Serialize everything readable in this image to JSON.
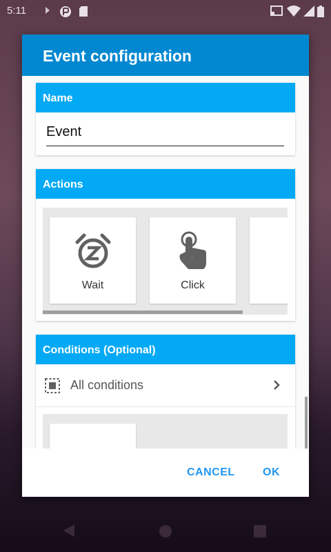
{
  "status_bar": {
    "time": "5:11",
    "icons": [
      "play-protect-icon",
      "app-notification-icon",
      "sd-card-icon",
      "cast-icon",
      "wifi-icon",
      "signal-icon",
      "battery-icon"
    ]
  },
  "dialog": {
    "title": "Event configuration",
    "name_section": {
      "header": "Name",
      "value": "Event"
    },
    "actions_section": {
      "header": "Actions",
      "items": [
        {
          "label": "Wait",
          "icon": "timer-z-icon"
        },
        {
          "label": "Click",
          "icon": "tap-hand-icon"
        }
      ]
    },
    "conditions_section": {
      "header": "Conditions (Optional)",
      "all_conditions_label": "All conditions",
      "icon": "select-all-icon"
    },
    "buttons": {
      "cancel": "CANCEL",
      "ok": "OK"
    }
  },
  "nav_bar": {
    "icons": [
      "back-icon",
      "home-icon",
      "recents-icon"
    ]
  },
  "colors": {
    "header_dark": "#0288d1",
    "section_header": "#03a9f4",
    "button_text": "#2196f3"
  }
}
